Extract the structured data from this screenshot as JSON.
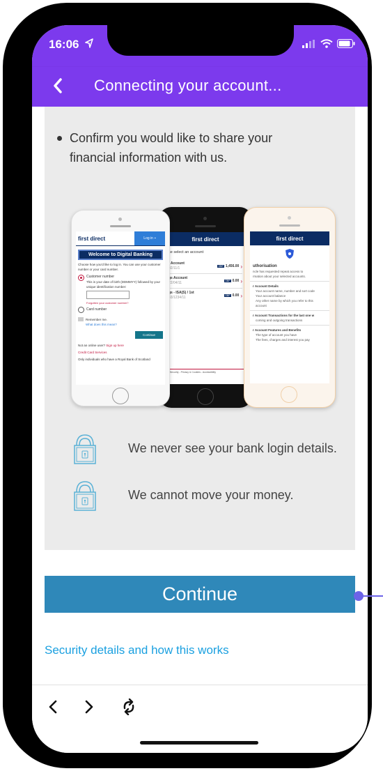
{
  "status_bar": {
    "time": "16:06"
  },
  "header": {
    "title": "Connecting your account..."
  },
  "content": {
    "bullet_text": "Confirm you would like to share your financial information with us.",
    "phones": {
      "left": {
        "brand": "first direct",
        "login_label": "Log in",
        "welcome": "Welcome to Digital Banking",
        "intro": "Choose how you'd like to log in. You can use your customer number or your card number.",
        "option_customer": "Customer number",
        "option_customer_desc": "This is your date of birth (DDMMYY) followed by your unique identification number:",
        "forgotten": "Forgotten your customer number?",
        "option_card": "Card number",
        "remember": "Remember me.",
        "what_mean": "What does this mean?",
        "continue": "Continue",
        "not_online": "Not an online user?",
        "sign_up": "Sign up here",
        "credit_card": "Credit Card Services",
        "only": "Only individuals who have a Royal Bank of Scotland"
      },
      "middle": {
        "brand": "first direct",
        "select": "se select an account",
        "accounts": [
          {
            "name": "t Account",
            "sub": "02/11/1",
            "amount": "1,456.00"
          },
          {
            "name": "gs Account",
            "sub": "22/04/11",
            "amount": "0.00"
          },
          {
            "name": "gs - ISA(S) / 1st",
            "sub": "33/1234/11",
            "amount": "0.00"
          }
        ],
        "footer": "ts - Security - Privacy & Cookies - Accessibility"
      },
      "right": {
        "brand": "first direct",
        "heading": "uthorisation",
        "sub1": "ncle has requested repeat access to",
        "sub2": "rmation about your selected accounts.",
        "section1": "r Account Details",
        "section1_items": [
          "Your account name, number and sort code",
          "Your account balance",
          "Any other name by which you refer to this account"
        ],
        "section2": "r Account Transactions for the last one w",
        "section2_items": [
          "coming and outgoing transactions"
        ],
        "section3": "r Account Features and Benefits",
        "section3_items": [
          "The type of account you have",
          "The fees, charges and interest you pay"
        ]
      }
    },
    "notices": [
      {
        "text": "We never see your bank login details."
      },
      {
        "text": "We cannot move your money."
      }
    ],
    "continue_label": "Continue",
    "security_link": "Security details and how this works"
  },
  "colors": {
    "header": "#7c3aed",
    "continue": "#2f88b9",
    "link": "#1aa0e0",
    "brand_bar": "#0b2c63"
  }
}
